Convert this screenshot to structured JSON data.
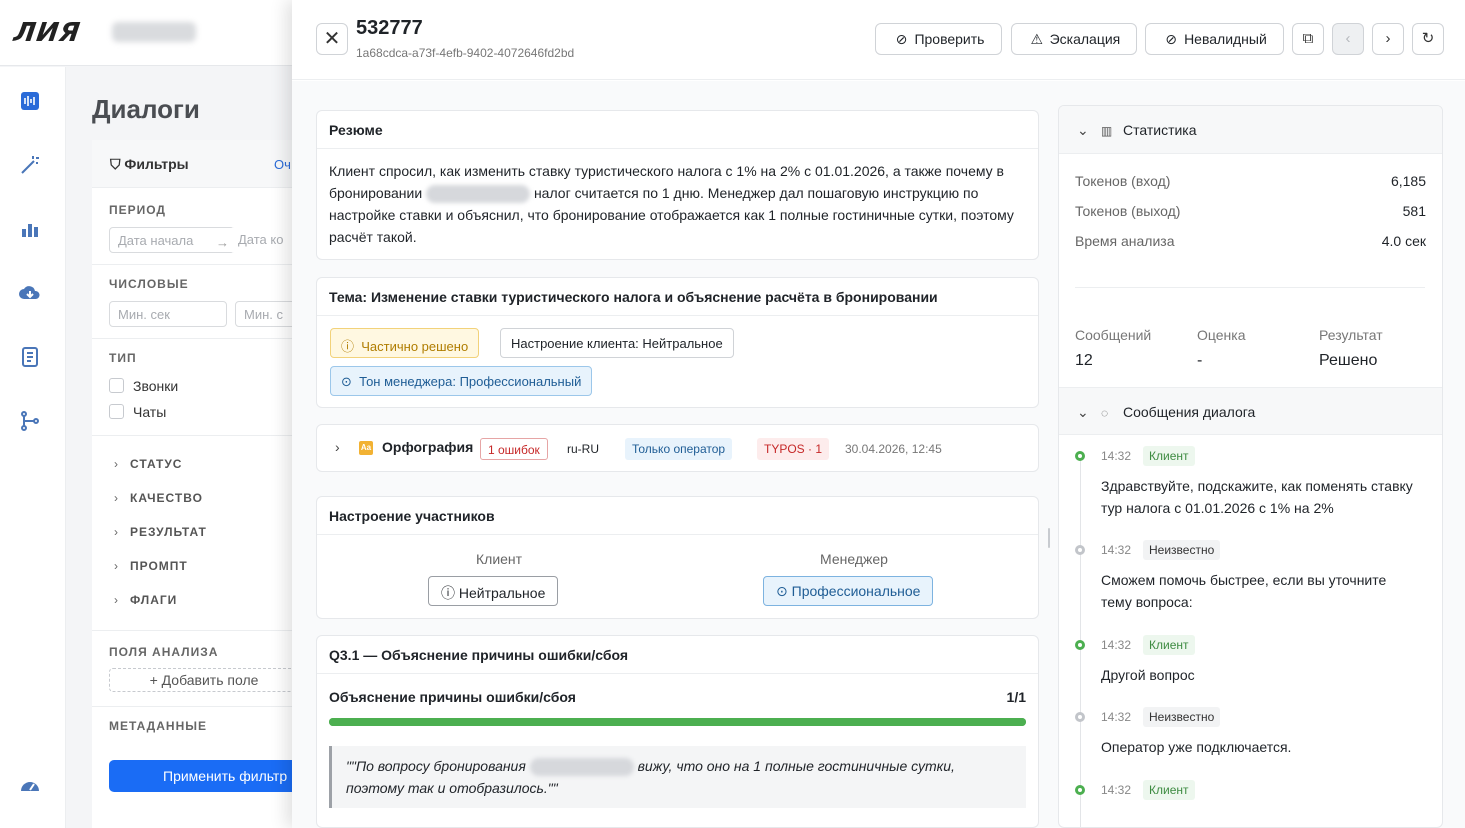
{
  "app": {
    "logo": "ЛИЯ",
    "page_title": "Диалоги"
  },
  "filters": {
    "title": "Фильтры",
    "clear": "Оч",
    "period_label": "ПЕРИОД",
    "date_start_placeholder": "Дата начала",
    "date_end_placeholder": "Дата ко",
    "numeric_label": "ЧИСЛОВЫЕ",
    "min_sec_placeholder": "Мин. сек",
    "min_second_placeholder": "Мин. с",
    "type_label": "ТИП",
    "type_calls": "Звонки",
    "type_chats": "Чаты",
    "groups": [
      "СТАТУС",
      "КАЧЕСТВО",
      "РЕЗУЛЬТАТ",
      "ПРОМПТ",
      "ФЛАГИ"
    ],
    "analysis_fields_label": "ПОЛЯ АНАЛИЗА",
    "add_field": "+ Добавить поле",
    "metadata_label": "МЕТАДАННЫЕ",
    "apply": "Применить фильтр"
  },
  "drawer": {
    "id": "532777",
    "uuid": "1a68cdca-a73f-4efb-9402-4072646fd2bd",
    "actions": {
      "check": "Проверить",
      "escalate": "Эскалация",
      "invalid": "Невалидный"
    },
    "summary": {
      "title": "Резюме",
      "text_part1": "Клиент спросил, как изменить ставку туристического налога с 1% на 2% с 01.01.2026, а также почему в бронировании",
      "text_part2": "налог считается по 1 дню. Менеджер дал пошаговую инструкцию по настройке ставки и объяснил, что бронирование отображается как 1 полные гостиничные сутки, поэтому расчёт такой."
    },
    "topic": {
      "title": "Тема: Изменение ставки туристического налога и объяснение расчёта в бронировании",
      "status_tag": "Частично решено",
      "mood_tag": "Настроение клиента: Нейтральное",
      "tone_tag": "Тон менеджера: Профессиональный"
    },
    "spelling": {
      "title": "Орфография",
      "errors": "1 ошибок",
      "locale": "ru-RU",
      "scope": "Только оператор",
      "typos": "TYPOS · 1",
      "date": "30.04.2026, 12:45"
    },
    "mood": {
      "title": "Настроение участников",
      "client_label": "Клиент",
      "client_value": "Нейтральное",
      "manager_label": "Менеджер",
      "manager_value": "Профессиональное"
    },
    "q31": {
      "title": "Q3.1 — Объяснение причины ошибки/сбоя",
      "criterion": "Объяснение причины ошибки/сбоя",
      "score": "1/1",
      "progress": 1.0,
      "quote_part1": "\"\"По вопросу бронирования",
      "quote_part2": "вижу, что оно на 1 полные гостиничные сутки,",
      "quote_part3": "поэтому так и отобразилось.\"\""
    }
  },
  "stats": {
    "title": "Статистика",
    "tokens_in_label": "Токенов (вход)",
    "tokens_in": "6,185",
    "tokens_out_label": "Токенов (выход)",
    "tokens_out": "581",
    "analysis_time_label": "Время анализа",
    "analysis_time": "4.0 сек",
    "messages_label": "Сообщений",
    "messages": "12",
    "rating_label": "Оценка",
    "rating": "-",
    "result_label": "Результат",
    "result": "Решено"
  },
  "messages": {
    "title": "Сообщения диалога",
    "items": [
      {
        "time": "14:32",
        "who": "Клиент",
        "text": "Здравствуйте, подскажите, как поменять ставку тур налога с 01.01.2026 с 1% на 2%"
      },
      {
        "time": "14:32",
        "who": "Неизвестно",
        "text": "Сможем помочь быстрее, если вы уточните тему вопроса:"
      },
      {
        "time": "14:32",
        "who": "Клиент",
        "text": "Другой вопрос"
      },
      {
        "time": "14:32",
        "who": "Неизвестно",
        "text": "Оператор уже подключается."
      },
      {
        "time": "14:32",
        "who": "Клиент",
        "text": ""
      }
    ]
  },
  "colors": {
    "accent": "#1a6cf5",
    "success": "#4caf50",
    "warning": "#b07d00",
    "info": "#1f5d95",
    "error": "#d32f2f"
  }
}
